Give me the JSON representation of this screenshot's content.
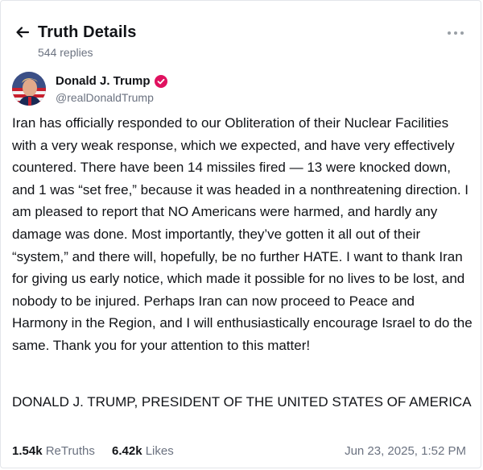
{
  "header": {
    "title": "Truth Details",
    "replies": "544 replies"
  },
  "author": {
    "name": "Donald J. Trump",
    "handle": "@realDonaldTrump",
    "verified_color": "#e0115f"
  },
  "post": {
    "body": "Iran has officially responded to our Obliteration of their Nuclear Facilities with a very weak response, which we expected, and have very effectively countered. There have been 14 missiles fired — 13 were knocked down, and 1 was “set free,” because it was headed in a nonthreatening direction. I am pleased to report that NO Americans were harmed, and hardly any damage was done. Most importantly, they’ve gotten it all out of their “system,” and there will, hopefully, be no further HATE. I want to thank Iran for giving us early notice, which made it possible for no lives to be lost, and nobody to be injured. Perhaps Iran can now proceed to Peace and Harmony in the Region, and I will enthusiastically encourage Israel to do the same. Thank you for your attention to this matter!",
    "signoff": "DONALD J. TRUMP, PRESIDENT OF THE UNITED STATES OF AMERICA"
  },
  "stats": {
    "retruths_count": "1.54k",
    "retruths_label": "ReTruths",
    "likes_count": "6.42k",
    "likes_label": "Likes",
    "timestamp": "Jun 23, 2025, 1:52 PM"
  }
}
